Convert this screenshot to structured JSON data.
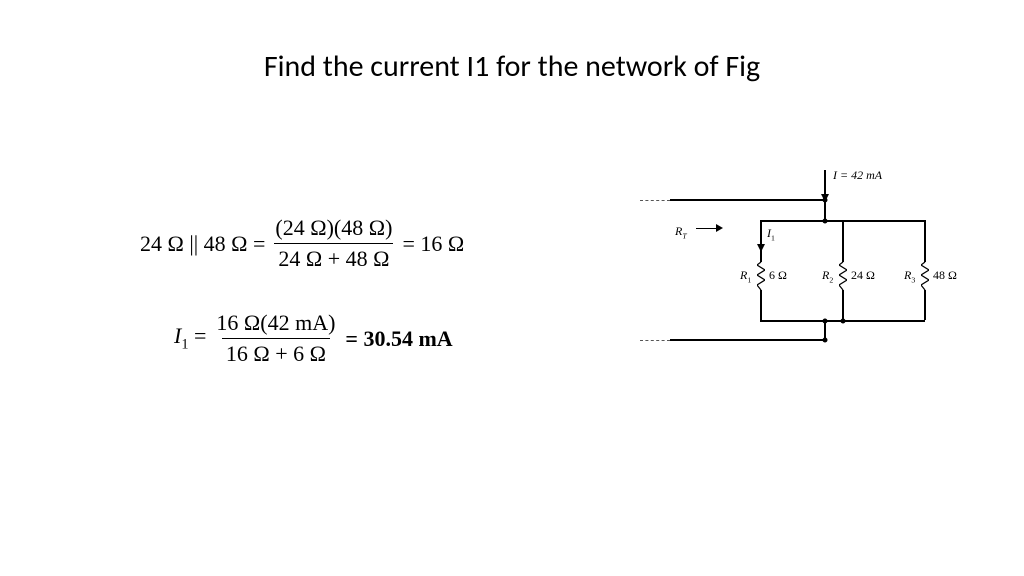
{
  "title": "Find the current I1 for the network of Fig",
  "eq1": {
    "lhs": "24 Ω || 48 Ω =",
    "num": "(24 Ω)(48 Ω)",
    "den": "24 Ω + 48 Ω",
    "rhs": "= 16 Ω"
  },
  "eq2": {
    "lhs_var": "I",
    "lhs_sub": "1",
    "eq": " =",
    "num": "16 Ω(42 mA)",
    "den": "16 Ω + 6 Ω",
    "rhs": "= 30.54 mA"
  },
  "circuit": {
    "source": "I  = 42 mA",
    "RT": "R",
    "RT_sub": "T",
    "I1": "I",
    "I1_sub": "1",
    "R1_name": "R",
    "R1_sub": "1",
    "R1_val": "6 Ω",
    "R2_name": "R",
    "R2_sub": "2",
    "R2_val": "24 Ω",
    "R3_name": "R",
    "R3_sub": "3",
    "R3_val": "48 Ω"
  }
}
